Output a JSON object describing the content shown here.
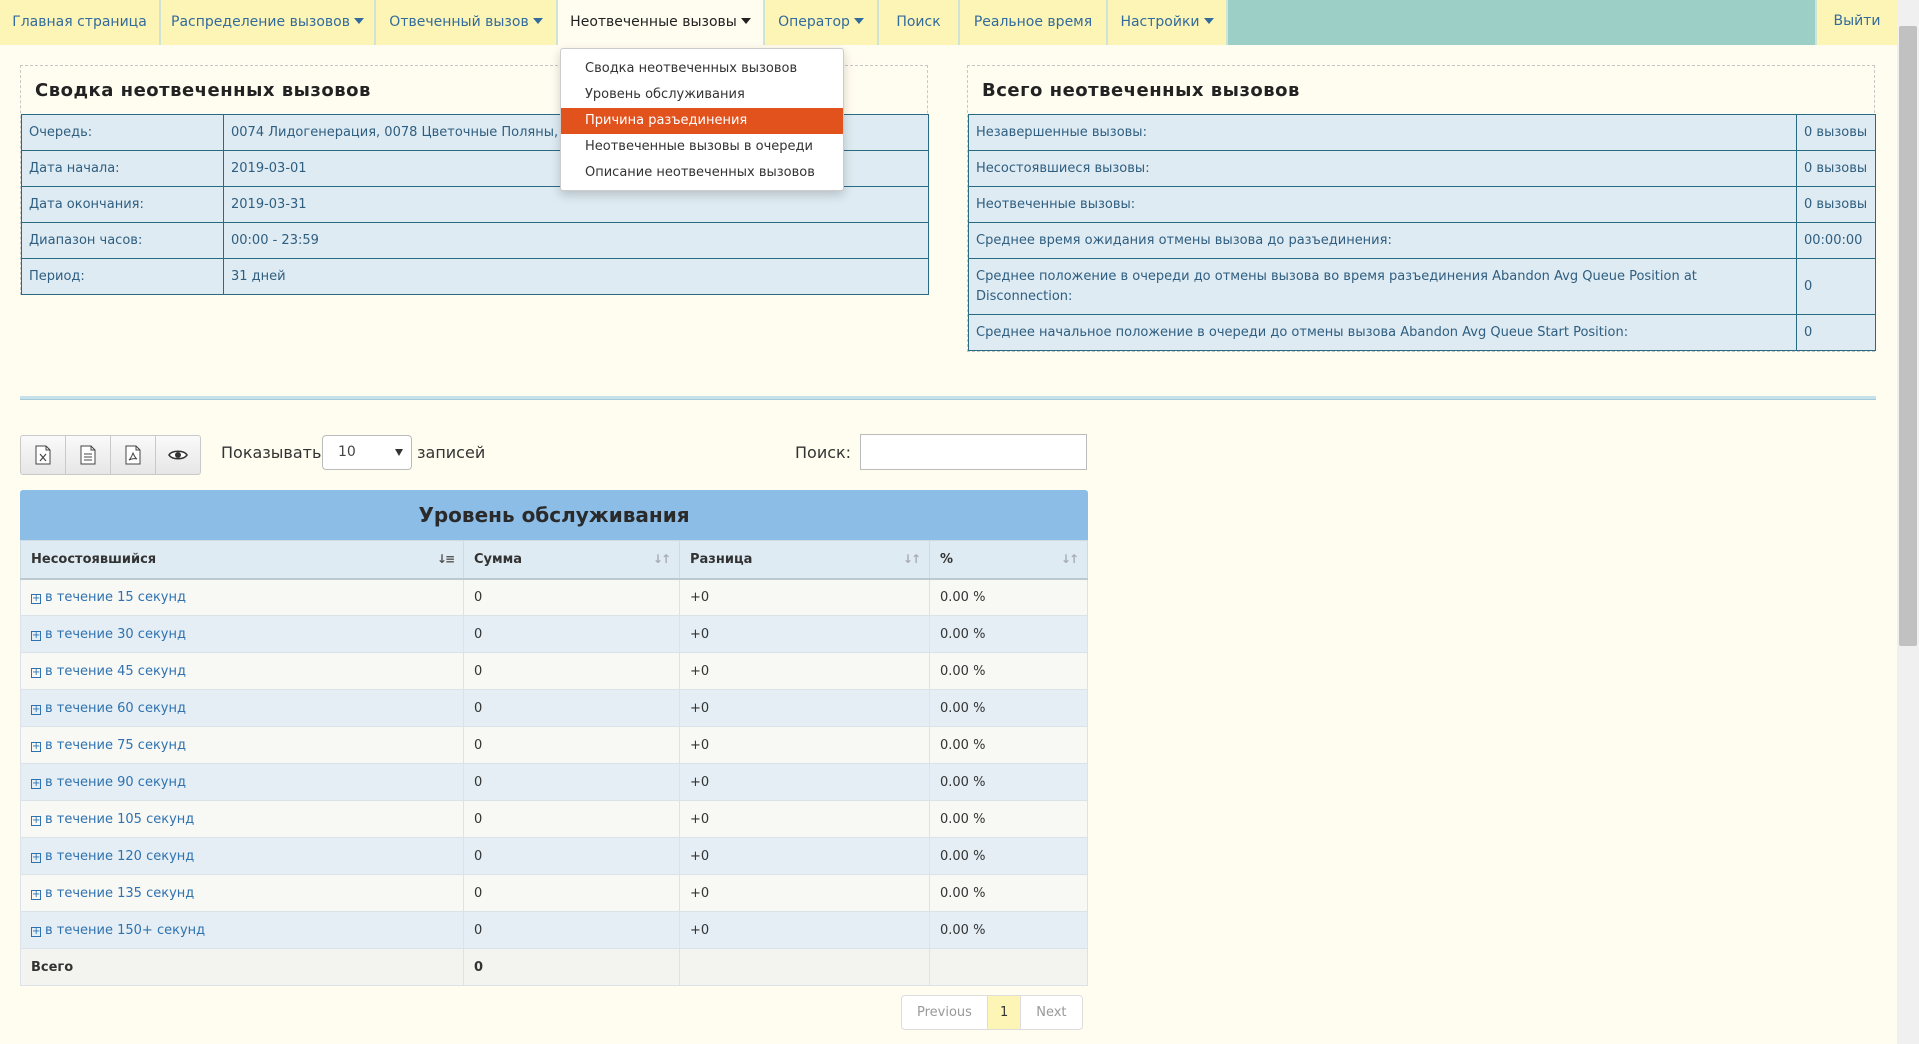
{
  "nav": {
    "items": [
      {
        "label": "Главная страница",
        "dropdown": false
      },
      {
        "label": "Распределение вызовов",
        "dropdown": true
      },
      {
        "label": "Отвеченный вызов",
        "dropdown": true
      },
      {
        "label": "Неотвеченные вызовы",
        "dropdown": true,
        "active": true
      },
      {
        "label": "Оператор",
        "dropdown": true
      },
      {
        "label": "Поиск",
        "dropdown": false
      },
      {
        "label": "Реальное время",
        "dropdown": false
      },
      {
        "label": "Настройки",
        "dropdown": true
      }
    ],
    "logout": "Выйти"
  },
  "dropdown_menu": {
    "items": [
      "Сводка неотвеченных вызовов",
      "Уровень обслуживания",
      "Причина разъединения",
      "Неотвеченные вызовы в очереди",
      "Описание неотвеченных вызовов"
    ],
    "highlighted_index": 2,
    "highlight_color": "#e2521d"
  },
  "summary_panel": {
    "title": "Сводка неотвеченных вызовов",
    "rows": [
      {
        "label": "Очередь:",
        "value": "0074 Лидогенерация, 0078 Цветочные Поляны, 0131 Сити центр"
      },
      {
        "label": "Дата начала:",
        "value": "2019-03-01"
      },
      {
        "label": "Дата окончания:",
        "value": "2019-03-31"
      },
      {
        "label": "Диапазон часов:",
        "value": "00:00 - 23:59"
      },
      {
        "label": "Период:",
        "value": "31 дней"
      }
    ]
  },
  "totals_panel": {
    "title": "Всего неотвеченных вызовов",
    "rows": [
      {
        "label": "Незавершенные вызовы:",
        "value": "0 вызовы"
      },
      {
        "label": "Несостоявшиеся вызовы:",
        "value": "0 вызовы"
      },
      {
        "label": "Неотвеченные вызовы:",
        "value": "0 вызовы"
      },
      {
        "label": "Среднее время ожидания отмены вызова до разъединения:",
        "value": "00:00:00"
      },
      {
        "label": "Среднее положение в очереди до отмены вызова во время разъединения Abandon Avg Queue Position at Disconnection:",
        "value": "0"
      },
      {
        "label": "Среднее начальное положение в очереди до отмены вызова Abandon Avg Queue Start Position:",
        "value": "0"
      }
    ]
  },
  "toolbar": {
    "export_icons": [
      "excel-icon",
      "csv-icon",
      "pdf-icon",
      "eye-icon"
    ],
    "show_label": "Показывать",
    "page_size": "10",
    "records_label": "записей",
    "search_label": "Поиск:",
    "search_value": ""
  },
  "table": {
    "caption": "Уровень обслуживания",
    "columns": [
      "Несостоявшийся",
      "Сумма",
      "Разница",
      "%"
    ],
    "rows": [
      [
        "в течение 15 секунд",
        "0",
        "+0",
        "0.00 %"
      ],
      [
        "в течение 30 секунд",
        "0",
        "+0",
        "0.00 %"
      ],
      [
        "в течение 45 секунд",
        "0",
        "+0",
        "0.00 %"
      ],
      [
        "в течение 60 секунд",
        "0",
        "+0",
        "0.00 %"
      ],
      [
        "в течение 75 секунд",
        "0",
        "+0",
        "0.00 %"
      ],
      [
        "в течение 90 секунд",
        "0",
        "+0",
        "0.00 %"
      ],
      [
        "в течение 105 секунд",
        "0",
        "+0",
        "0.00 %"
      ],
      [
        "в течение 120 секунд",
        "0",
        "+0",
        "0.00 %"
      ],
      [
        "в течение 135 секунд",
        "0",
        "+0",
        "0.00 %"
      ],
      [
        "в течение 150+ секунд",
        "0",
        "+0",
        "0.00 %"
      ]
    ],
    "total_row": [
      "Всего",
      "0",
      "",
      ""
    ]
  },
  "pagination": {
    "previous": "Previous",
    "current": "1",
    "next": "Next"
  },
  "colors": {
    "nav_bar": "#9ccfc6",
    "nav_tab": "#fdf5b6",
    "table_caption": "#8cbde6",
    "page_bg": "#fffcf0"
  }
}
